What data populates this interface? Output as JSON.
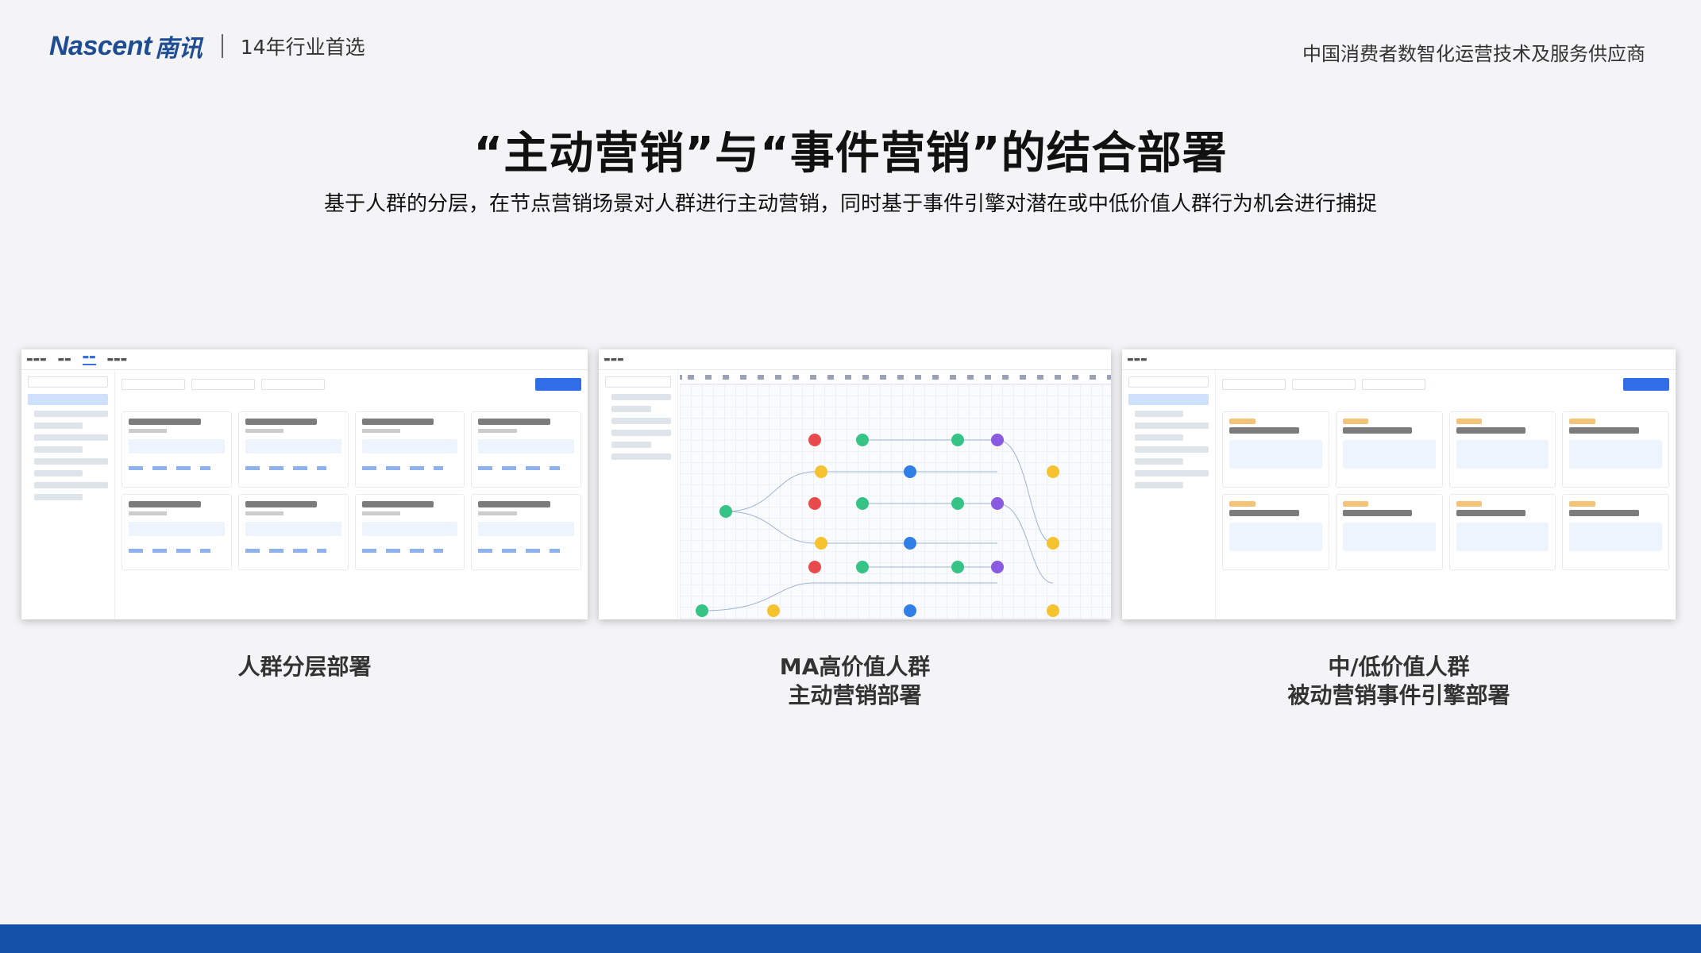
{
  "header": {
    "logo_text": "Nascent",
    "logo_cn": "南讯",
    "tagline": "14年行业首选",
    "company": "中国消费者数智化运营技术及服务供应商"
  },
  "slide": {
    "title": "“主动营销”与“事件营销”的结合部署",
    "subtitle": "基于人群的分层，在节点营销场景对人群进行主动营销，同时基于事件引擎对潜在或中低价值人群行为机会进行捕捉"
  },
  "panels": [
    {
      "caption_line1": "人群分层部署",
      "caption_line2": ""
    },
    {
      "caption_line1": "MA高价值人群",
      "caption_line2": "主动营销部署"
    },
    {
      "caption_line1": "中/低价值人群",
      "caption_line2": "被动营销事件引擎部署"
    }
  ],
  "colors": {
    "brand": "#1f4d93",
    "bottom_bar": "#1350a8",
    "accent": "#2f6ee6"
  }
}
